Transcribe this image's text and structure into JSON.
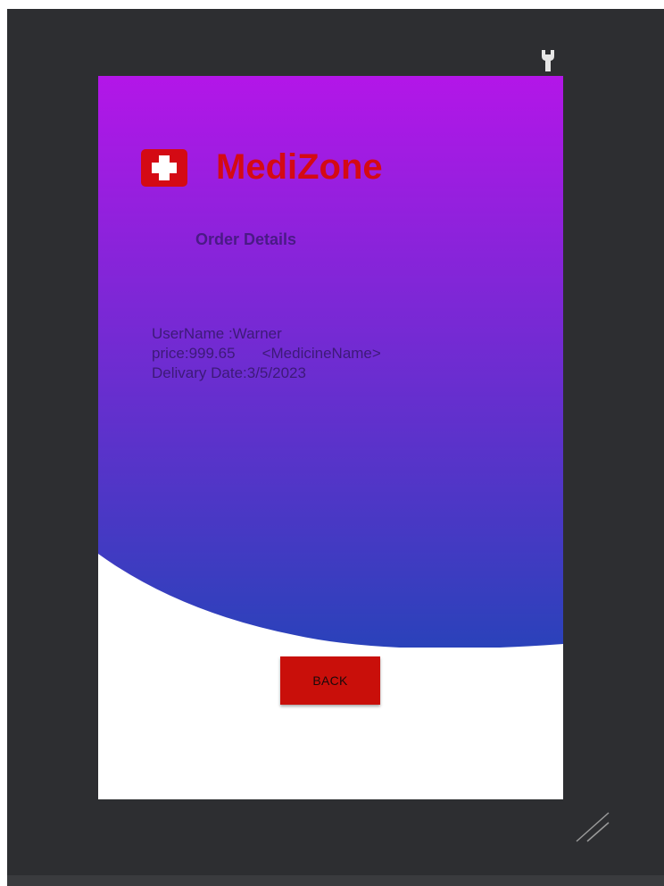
{
  "app": {
    "brand_name": "MediZone",
    "brand_color": "#d40a14",
    "logo_icon": "medical-cross-icon"
  },
  "page": {
    "title": "Order Details"
  },
  "order": {
    "username_line": "UserName :Warner",
    "price_text": "price:999.65",
    "medicine_name": "<MedicineName>",
    "delivery_line": "Delivary Date:3/5/2023"
  },
  "actions": {
    "back_label": "BACK"
  },
  "theme": {
    "gradient_top": "#b316e8",
    "gradient_bottom": "#2a42ba",
    "button_color": "#c90f0a",
    "editor_background": "#2d2e31"
  },
  "editor": {
    "wrench_icon": "wrench-icon",
    "resize_icon": "resize-handle-icon"
  }
}
